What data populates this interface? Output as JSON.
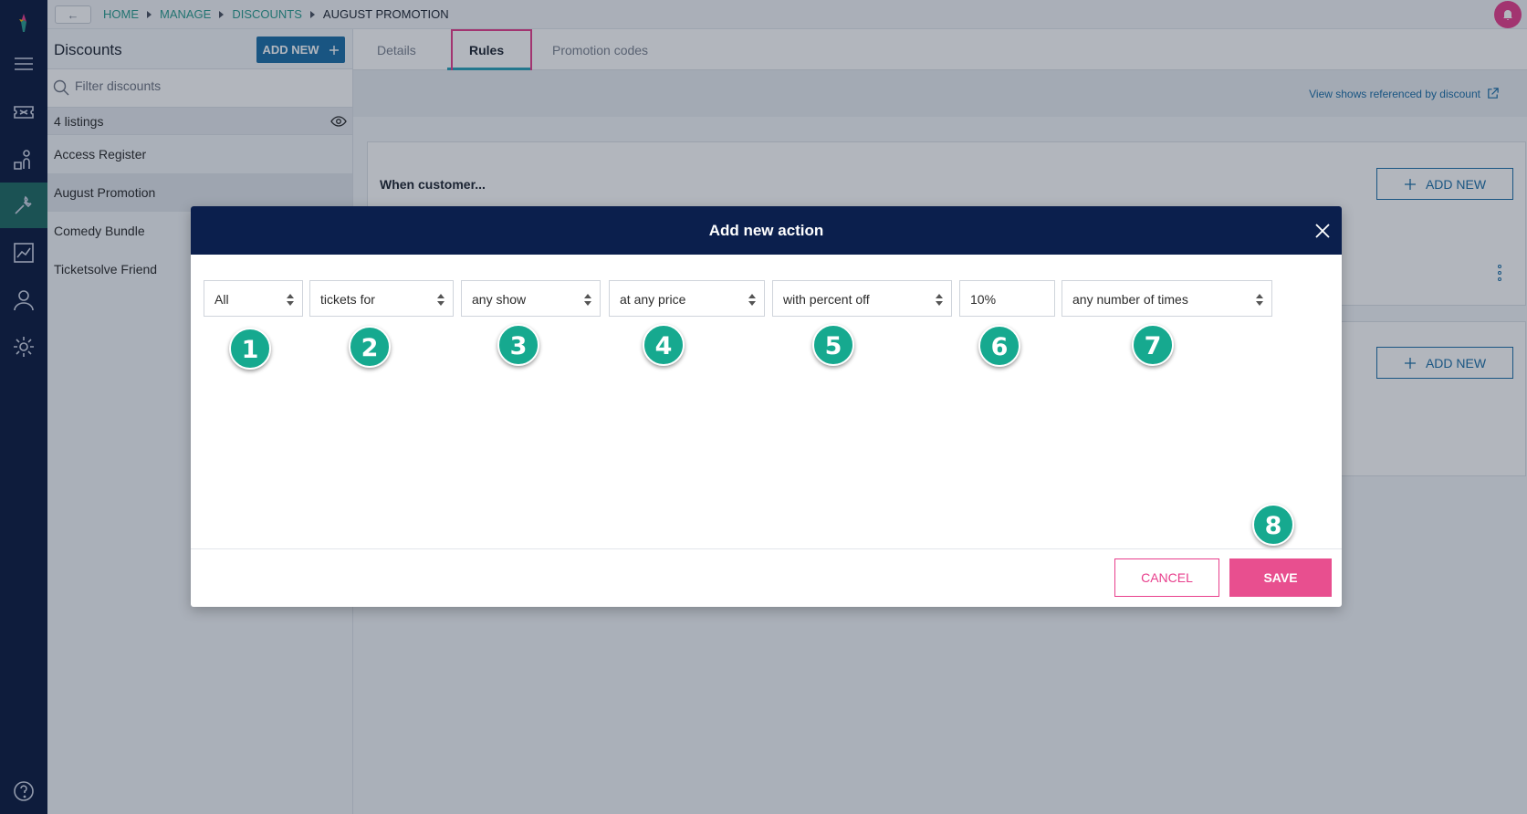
{
  "topbar": {
    "back_label": "←",
    "breadcrumbs": [
      "HOME",
      "MANAGE",
      "DISCOUNTS",
      "AUGUST PROMOTION"
    ]
  },
  "sidebar": {
    "title": "Discounts",
    "add_new_label": "ADD NEW",
    "filter_placeholder": "Filter discounts",
    "count_label": "4 listings",
    "items": [
      {
        "label": "Access Register"
      },
      {
        "label": "August Promotion"
      },
      {
        "label": "Comedy Bundle"
      },
      {
        "label": "Ticketsolve Friend"
      }
    ]
  },
  "main": {
    "tabs": [
      {
        "label": "Details"
      },
      {
        "label": "Rules"
      },
      {
        "label": "Promotion codes"
      }
    ],
    "view_link": "View shows referenced by discount",
    "card_title": "When customer...",
    "card_add_label": "ADD NEW"
  },
  "modal": {
    "title": "Add new action",
    "fields": [
      {
        "value": "All",
        "badge": "1"
      },
      {
        "value": "tickets for",
        "badge": "2"
      },
      {
        "value": "any show",
        "badge": "3"
      },
      {
        "value": "at any price",
        "badge": "4"
      },
      {
        "value": "with percent off",
        "badge": "5"
      },
      {
        "value": "10%",
        "badge": "6"
      },
      {
        "value": "any number of times",
        "badge": "7"
      }
    ],
    "save_badge": "8",
    "cancel_label": "CANCEL",
    "save_label": "SAVE"
  },
  "colors": {
    "nav": "#0b1a3f",
    "accent_teal": "#2a9d8f",
    "primary_blue": "#1b6fa8",
    "pink": "#e83e8c",
    "badge_green": "#16a98f",
    "modal_header": "#0b1f4d"
  }
}
